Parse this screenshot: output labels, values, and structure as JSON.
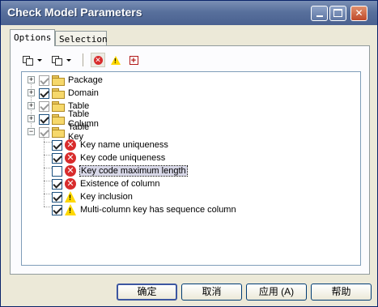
{
  "window": {
    "title": "Check Model Parameters"
  },
  "tabs": [
    {
      "label": "Options"
    },
    {
      "label": "Selection"
    }
  ],
  "toolbar": {
    "icons": [
      "copy-dropdown-icon",
      "paste-dropdown-icon",
      "error-filter-icon",
      "warning-filter-icon",
      "add-check-icon"
    ]
  },
  "tree": {
    "items": [
      {
        "label": "Package",
        "level": 0,
        "expander": "+",
        "checked": true,
        "grayed": true,
        "icon": "folder-icon"
      },
      {
        "label": "Domain",
        "level": 0,
        "expander": "+",
        "checked": true,
        "grayed": false,
        "icon": "folder-icon"
      },
      {
        "label": "Table",
        "level": 0,
        "expander": "+",
        "checked": true,
        "grayed": true,
        "icon": "folder-icon"
      },
      {
        "label": "Table Column",
        "level": 0,
        "expander": "+",
        "checked": true,
        "grayed": false,
        "icon": "folder-icon"
      },
      {
        "label": "Table Key",
        "level": 0,
        "expander": "-",
        "checked": true,
        "grayed": true,
        "icon": "folder-icon"
      },
      {
        "label": "Key name uniqueness",
        "level": 1,
        "checked": true,
        "icon": "error-icon"
      },
      {
        "label": "Key code uniqueness",
        "level": 1,
        "checked": true,
        "icon": "error-icon"
      },
      {
        "label": "Key code maximum length",
        "level": 1,
        "checked": false,
        "icon": "error-icon",
        "selected": true
      },
      {
        "label": "Existence of column",
        "level": 1,
        "checked": true,
        "icon": "error-icon"
      },
      {
        "label": "Key inclusion",
        "level": 1,
        "checked": true,
        "icon": "warning-icon"
      },
      {
        "label": "Multi-column key has sequence column",
        "level": 1,
        "checked": true,
        "icon": "warning-icon"
      }
    ]
  },
  "buttons": {
    "ok": "确定",
    "cancel": "取消",
    "apply": "应用 (A)",
    "help": "帮助"
  }
}
